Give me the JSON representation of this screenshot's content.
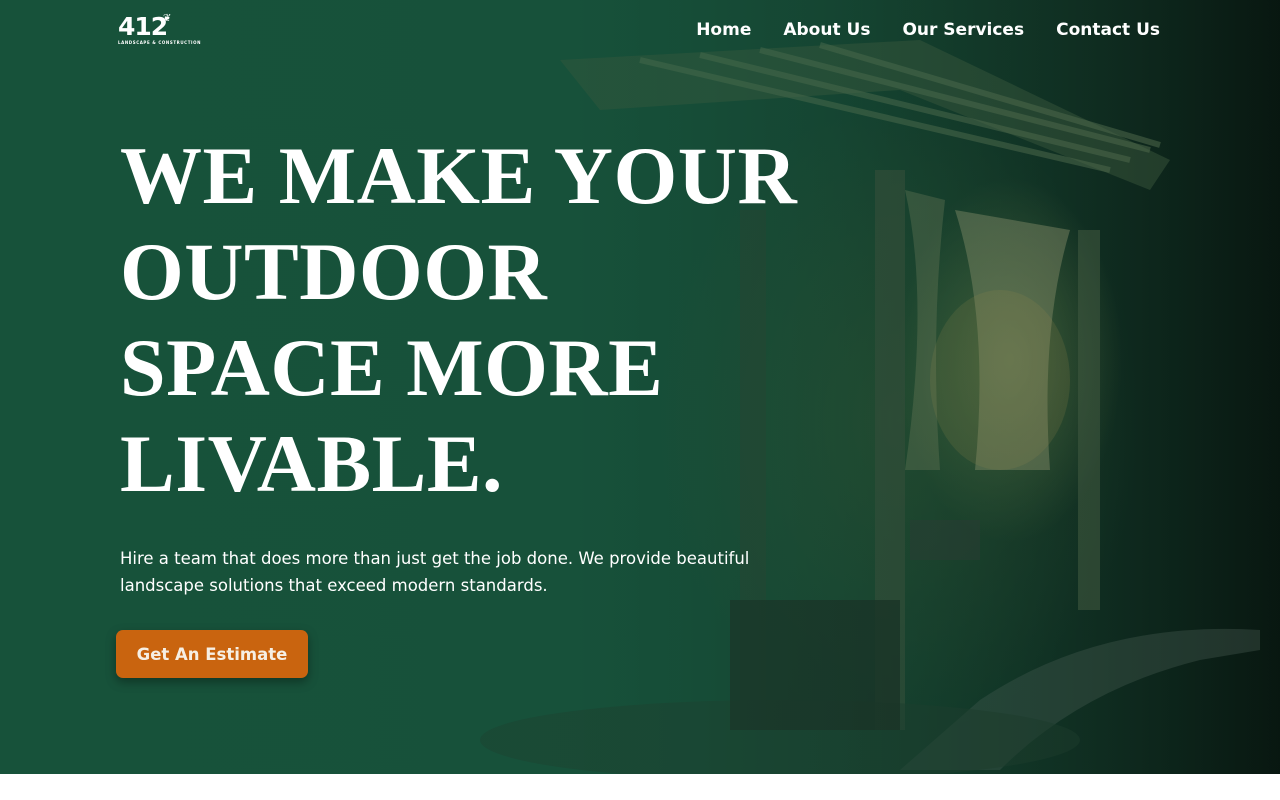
{
  "brand": {
    "logo_number": "412",
    "logo_tagline": "LANDSCAPE & CONSTRUCTION",
    "logo_leaf": "❦"
  },
  "nav": {
    "items": [
      "Home",
      "About Us",
      "Our Services",
      "Contact Us"
    ]
  },
  "hero": {
    "headline_lines": [
      "WE MAKE YOUR",
      "OUTDOOR",
      "SPACE MORE",
      "LIVABLE."
    ],
    "lead_lines": [
      "Hire a team that does more than just get the job done. We provide beautiful",
      "landscape solutions that exceed modern standards."
    ],
    "cta_label": "Get An Estimate"
  },
  "colors": {
    "hero_green": "#17513a",
    "cta_orange": "#c9640f",
    "text": "#ffffff"
  }
}
